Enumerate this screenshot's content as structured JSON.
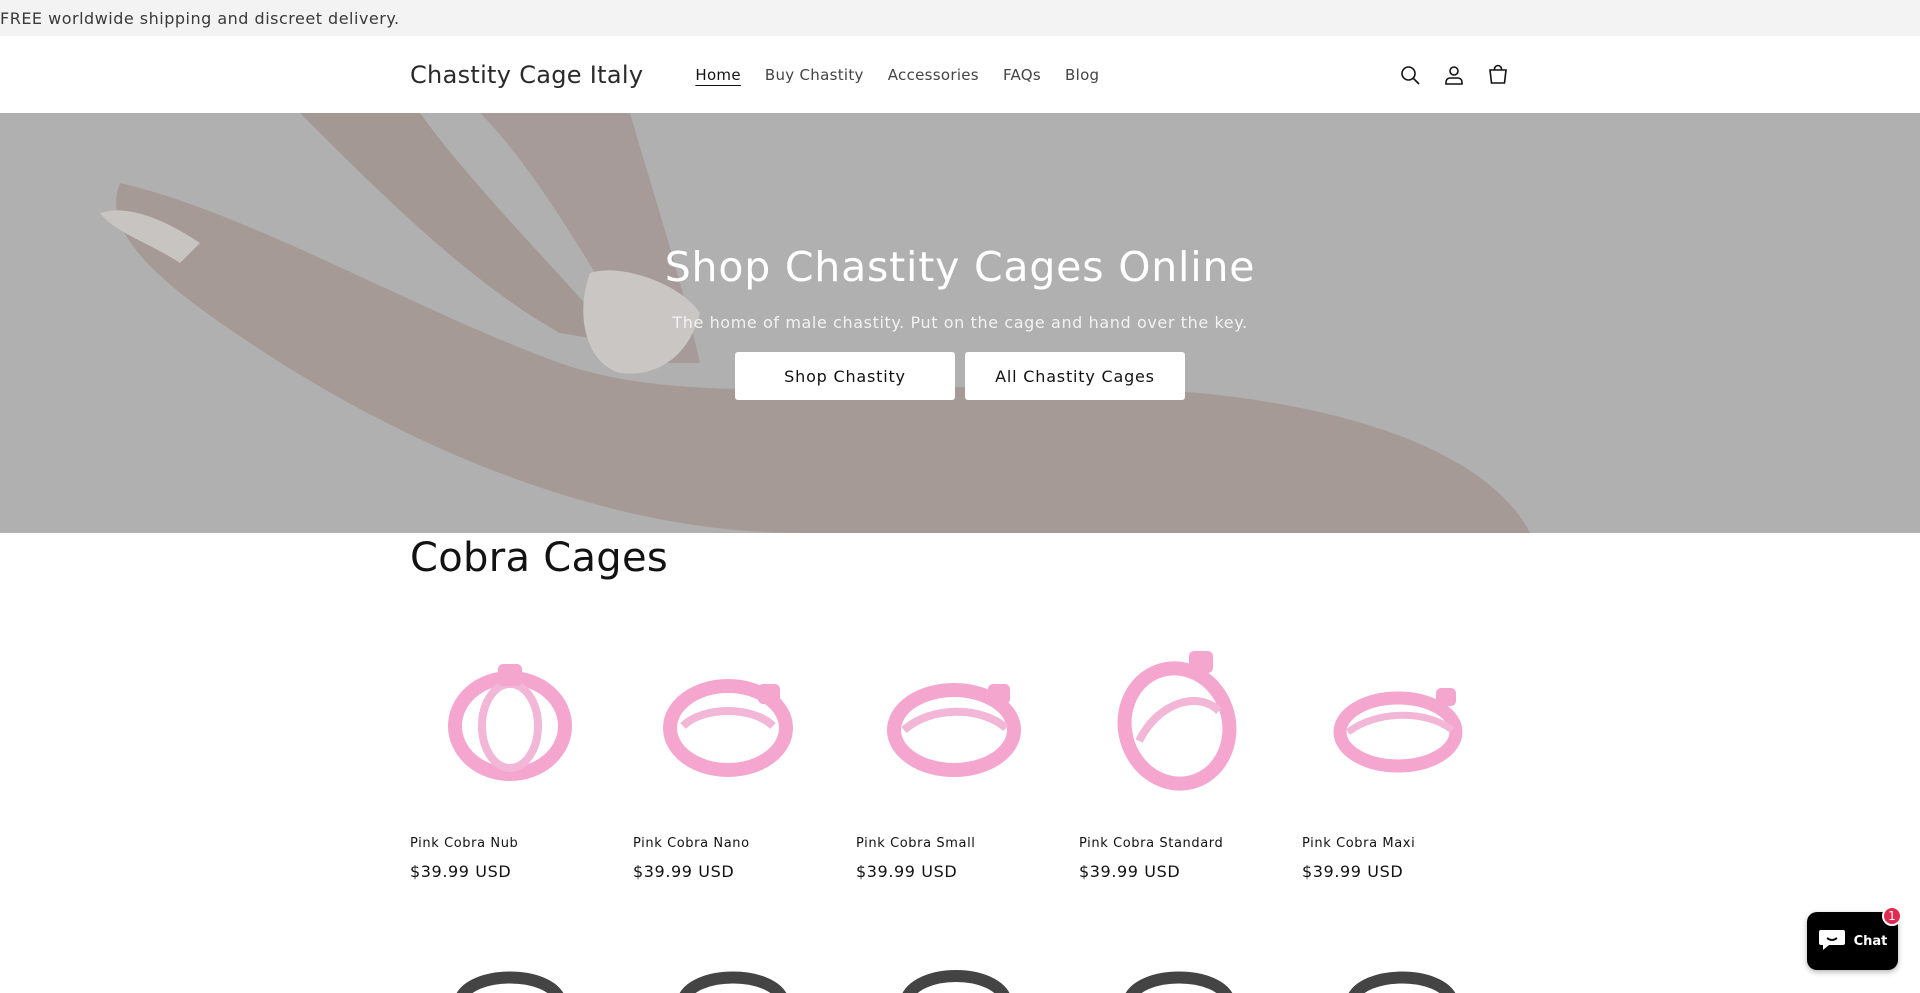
{
  "announcement": {
    "text": "FREE worldwide shipping and discreet delivery."
  },
  "header": {
    "logo": "Chastity Cage Italy",
    "nav": [
      {
        "label": "Home",
        "active": true
      },
      {
        "label": "Buy Chastity",
        "active": false
      },
      {
        "label": "Accessories",
        "active": false
      },
      {
        "label": "FAQs",
        "active": false
      },
      {
        "label": "Blog",
        "active": false
      }
    ],
    "icons": [
      "search-icon",
      "account-icon",
      "cart-icon"
    ]
  },
  "hero": {
    "title": "Shop Chastity Cages Online",
    "subtitle": "The home of male chastity. Put on the cage and hand over the key.",
    "buttons": [
      "Shop Chastity",
      "All Chastity Cages"
    ]
  },
  "collection": {
    "title": "Cobra Cages",
    "products": [
      {
        "name": "Pink Cobra Nub",
        "price": "$39.99 USD"
      },
      {
        "name": "Pink Cobra Nano",
        "price": "$39.99 USD"
      },
      {
        "name": "Pink Cobra Small",
        "price": "$39.99 USD"
      },
      {
        "name": "Pink Cobra Standard",
        "price": "$39.99 USD"
      },
      {
        "name": "Pink Cobra Maxi",
        "price": "$39.99 USD"
      }
    ]
  },
  "chat": {
    "label": "Chat",
    "badge": "1"
  },
  "colors": {
    "product_pink": "#f4a6cf",
    "hero_overlay": "#b0b0b0",
    "chat_bg": "#000000",
    "badge": "#e02a4f"
  }
}
